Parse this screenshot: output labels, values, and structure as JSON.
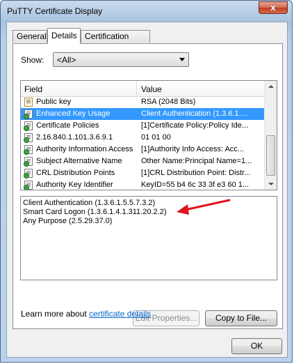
{
  "window": {
    "title": "PuTTY Certificate Display",
    "close_glyph": "x"
  },
  "tabs": [
    {
      "label": "General"
    },
    {
      "label": "Details",
      "active": true
    },
    {
      "label": "Certification Path"
    }
  ],
  "show": {
    "label": "Show:",
    "value": "<All>"
  },
  "list": {
    "columns": {
      "field": "Field",
      "value": "Value"
    },
    "rows": [
      {
        "field": "Public key",
        "value": "RSA (2048 Bits)",
        "icon": "certificate-field-icon"
      },
      {
        "field": "Enhanced Key Usage",
        "value": "Client Authentication (1.3.6.1....",
        "icon": "certificate-extension-icon",
        "selected": true
      },
      {
        "field": "Certificate Policies",
        "value": "[1]Certificate Policy:Policy Ide...",
        "icon": "certificate-extension-icon"
      },
      {
        "field": "2.16.840.1.101.3.6.9.1",
        "value": "01 01 00",
        "icon": "certificate-extension-icon"
      },
      {
        "field": "Authority Information Access",
        "value": "[1]Authority Info Access: Acc...",
        "icon": "certificate-extension-icon"
      },
      {
        "field": "Subject Alternative Name",
        "value": "Other Name:Principal Name=1...",
        "icon": "certificate-extension-icon"
      },
      {
        "field": "CRL Distribution Points",
        "value": "[1]CRL Distribution Point: Distr...",
        "icon": "certificate-extension-icon"
      },
      {
        "field": "Authority Key Identifier",
        "value": "KeyID=55 b4 6c 33 3f e3 60 1...",
        "icon": "certificate-extension-icon"
      }
    ]
  },
  "detail_lines": [
    "Client Authentication (1.3.6.1.5.5.7.3.2)",
    "Smart Card Logon (1.3.6.1.4.1.311.20.2.2)",
    "Any Purpose (2.5.29.37.0)"
  ],
  "buttons": {
    "edit_properties": "Edit Properties...",
    "copy_to_file": "Copy to File...",
    "ok": "OK"
  },
  "learn": {
    "prefix": "Learn more about ",
    "link": "certificate details"
  },
  "colors": {
    "selection": "#3399ff",
    "annotation_arrow": "#e0141e",
    "link": "#0066cc"
  }
}
